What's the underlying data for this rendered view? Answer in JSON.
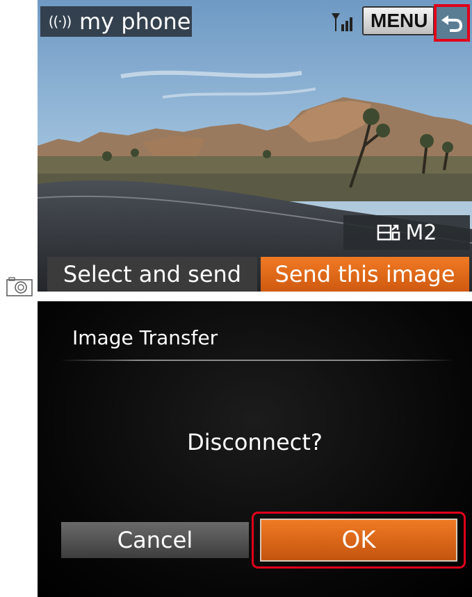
{
  "screen1": {
    "connection_name": "my phone",
    "wifi_icon": "wifi-icon",
    "signal_icon": "signal-strength-icon",
    "menu_label": "MENU",
    "back_icon": "back-arrow-icon",
    "mode_label": "M2",
    "mode_icon": "send-image-icon",
    "select_and_send_label": "Select and send",
    "send_this_image_label": "Send this image",
    "camera_icon": "camera-icon"
  },
  "screen2": {
    "title": "Image Transfer",
    "message": "Disconnect?",
    "cancel_label": "Cancel",
    "ok_label": "OK"
  },
  "colors": {
    "accent_orange": "#e46a1a",
    "highlight_red": "#e0001a"
  }
}
